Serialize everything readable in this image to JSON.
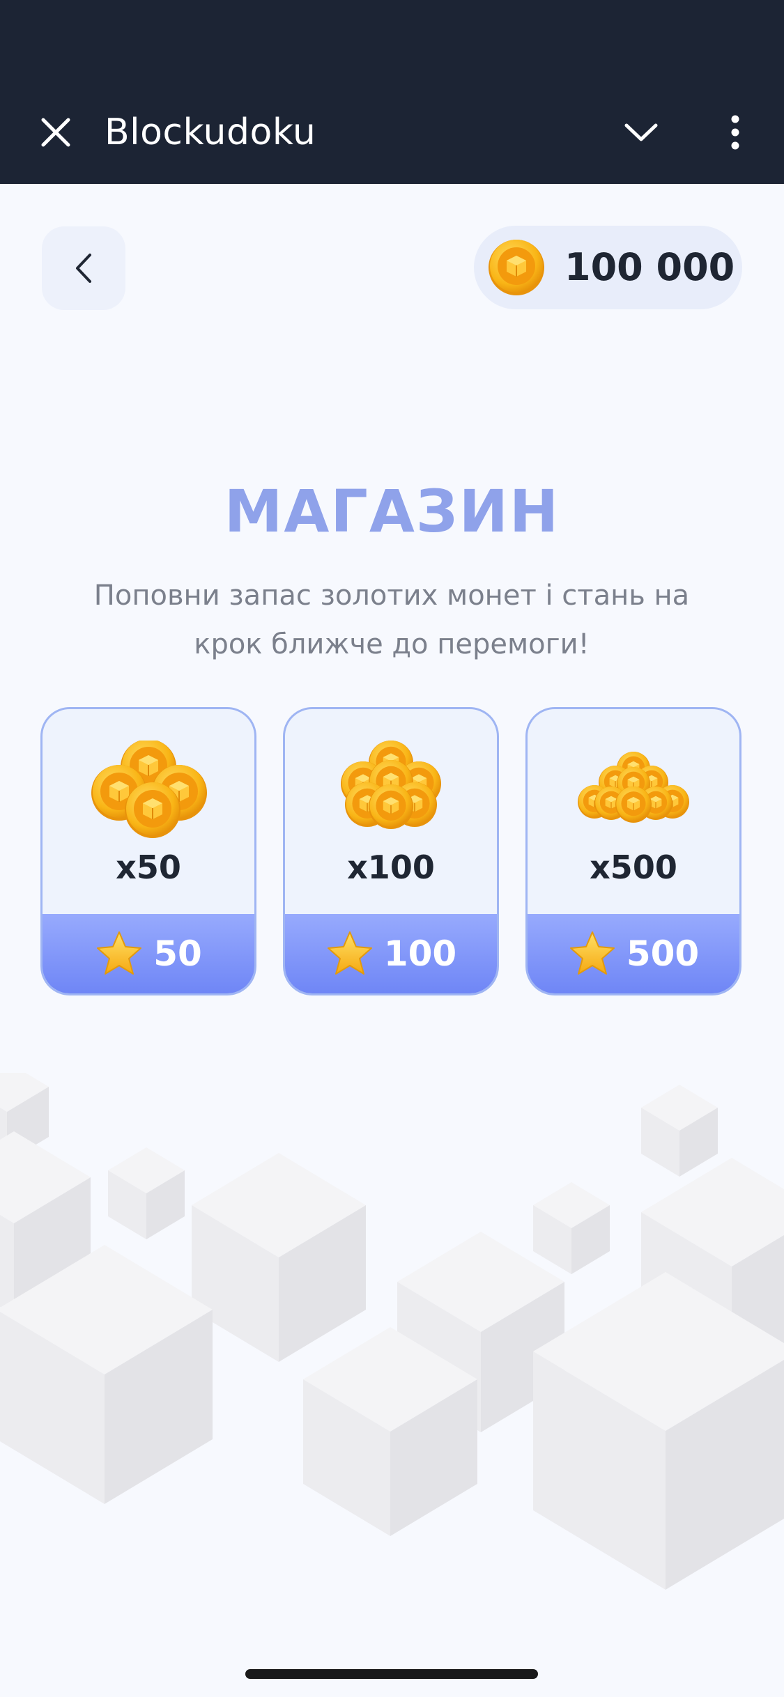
{
  "app": {
    "title": "Blockudoku",
    "icons": {
      "close": "close-icon",
      "collapse": "chevron-down-icon",
      "more": "more-vertical-icon"
    }
  },
  "header": {
    "back_icon": "back-chevron-icon",
    "balance": "100 000",
    "balance_icon": "gold-coin-icon"
  },
  "shop": {
    "title": "МАГАЗИН",
    "subtitle": "Поповни запас золотих монет і стань на крок ближче до перемоги!"
  },
  "offers": [
    {
      "qty": "x50",
      "price": "50"
    },
    {
      "qty": "x100",
      "price": "100"
    },
    {
      "qty": "x500",
      "price": "500"
    }
  ],
  "colors": {
    "topbar": "#1c2434",
    "title": "#8fa2ea",
    "card_border": "#9fb5f3",
    "price_bar": "#6f86f6",
    "coin": "#f7b21a",
    "star": "#f8c21c"
  }
}
